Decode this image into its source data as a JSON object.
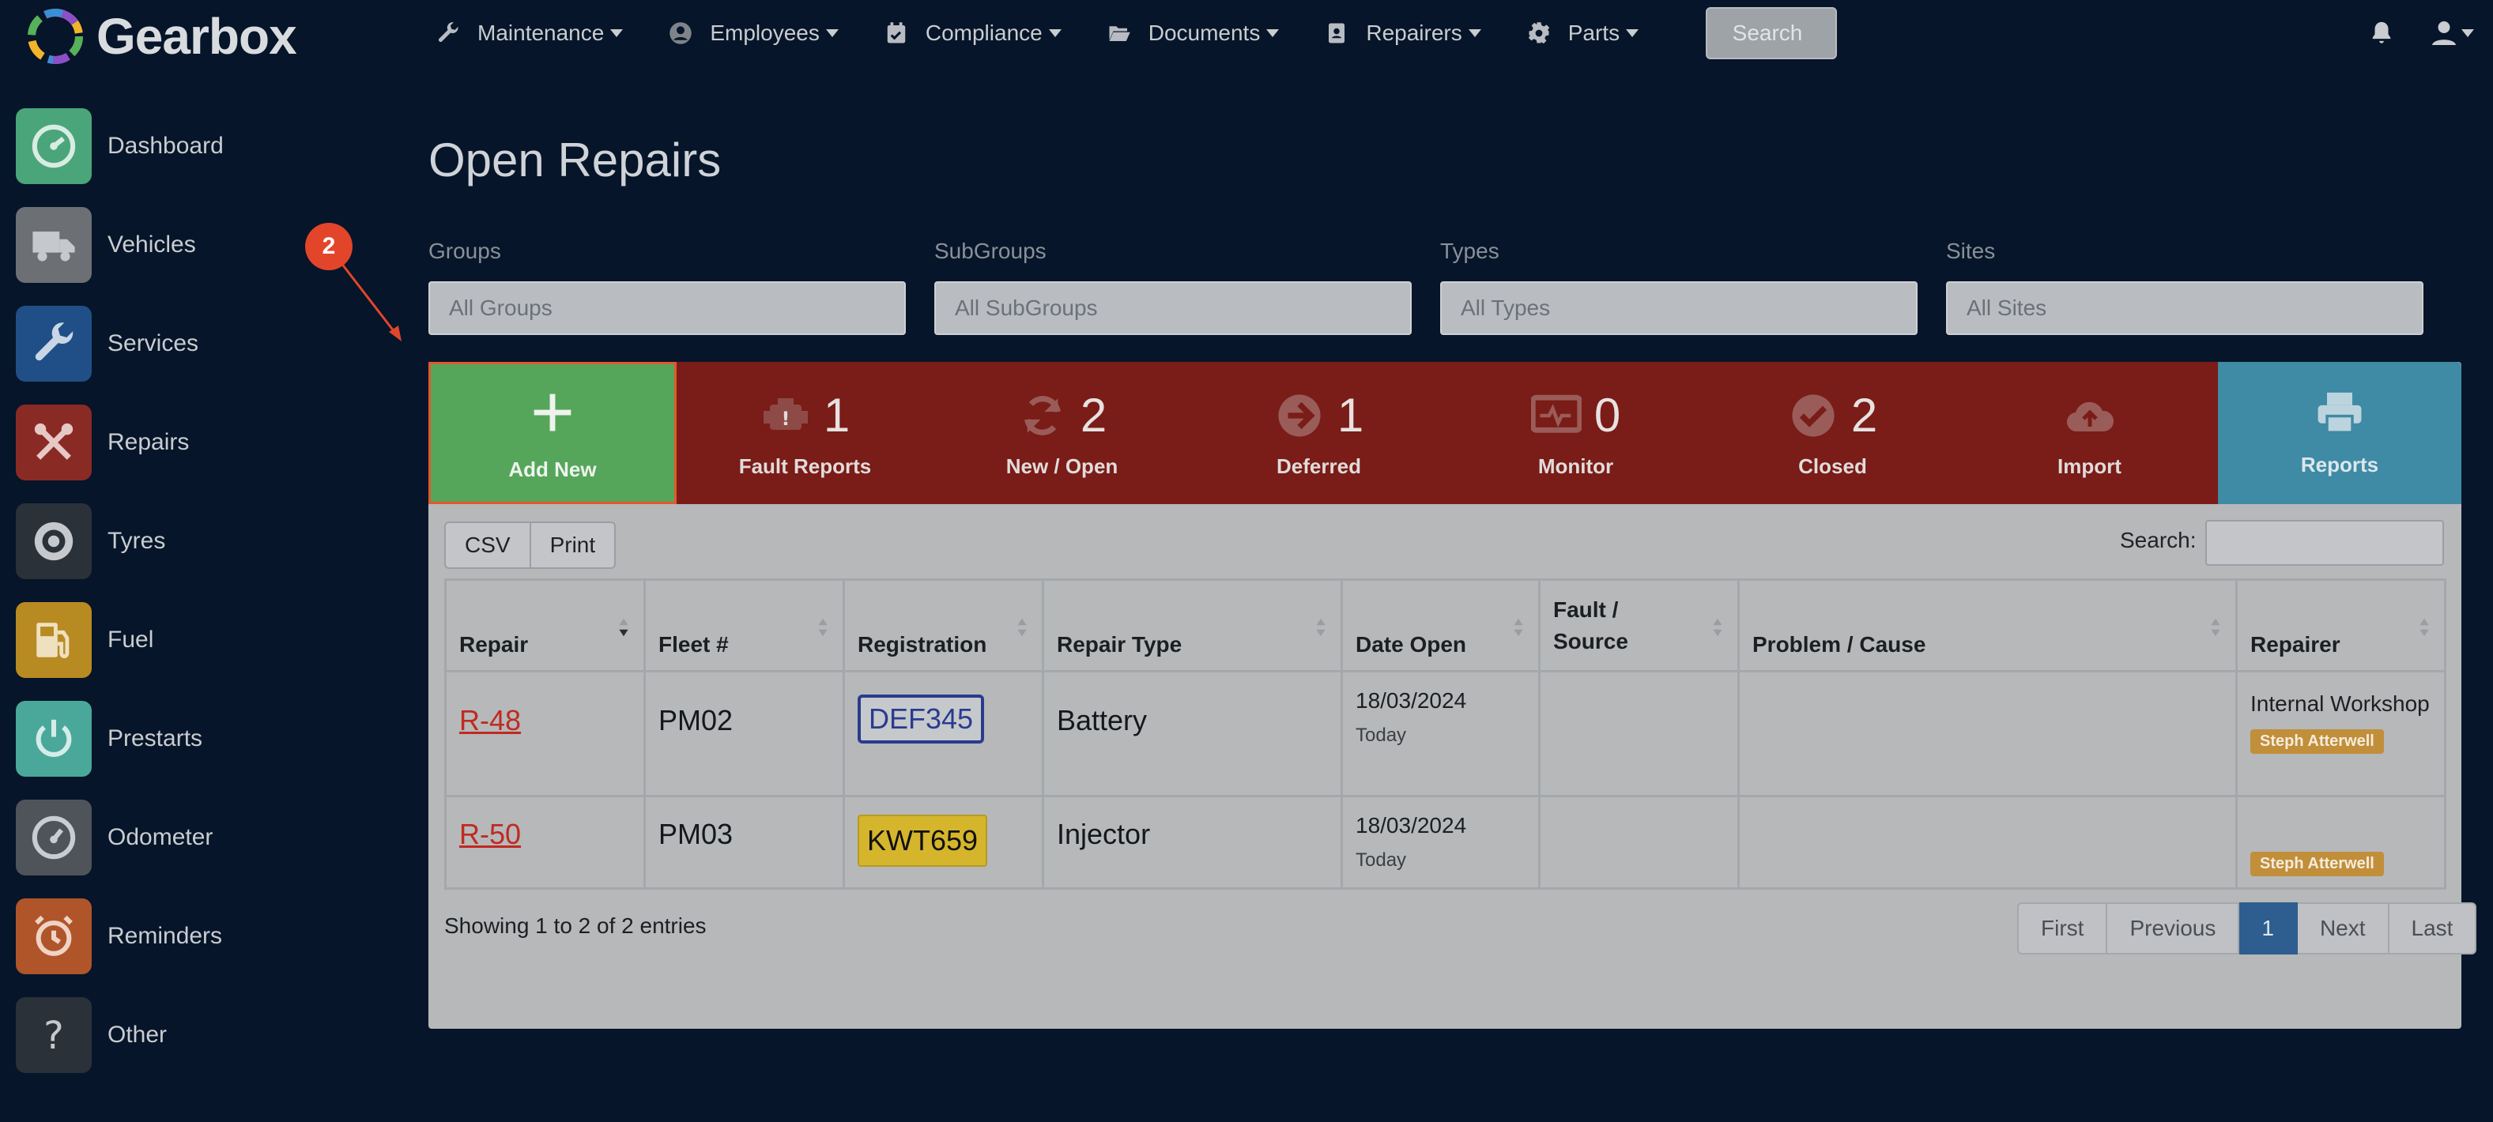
{
  "app": {
    "name": "Gearbox"
  },
  "topnav": {
    "items": [
      {
        "label": "Maintenance",
        "icon": "wrench-icon"
      },
      {
        "label": "Employees",
        "icon": "person-icon"
      },
      {
        "label": "Compliance",
        "icon": "calendar-check-icon"
      },
      {
        "label": "Documents",
        "icon": "folder-open-icon"
      },
      {
        "label": "Repairers",
        "icon": "address-book-icon"
      },
      {
        "label": "Parts",
        "icon": "gear-icon"
      }
    ],
    "search_label": "Search"
  },
  "sidebar": {
    "items": [
      {
        "label": "Dashboard",
        "icon": "dashboard-icon",
        "color": "#4aa57a"
      },
      {
        "label": "Vehicles",
        "icon": "truck-icon",
        "color": "#6c7075"
      },
      {
        "label": "Services",
        "icon": "wrench-icon",
        "color": "#1f4f86"
      },
      {
        "label": "Repairs",
        "icon": "tools-icon",
        "color": "#8a2a25"
      },
      {
        "label": "Tyres",
        "icon": "tyre-icon",
        "color": "#2b3138"
      },
      {
        "label": "Fuel",
        "icon": "fuel-pump-icon",
        "color": "#b88a22"
      },
      {
        "label": "Prestarts",
        "icon": "power-icon",
        "color": "#4aa89a"
      },
      {
        "label": "Odometer",
        "icon": "gauge-icon",
        "color": "#4f545a"
      },
      {
        "label": "Reminders",
        "icon": "alarm-clock-icon",
        "color": "#b0552a"
      },
      {
        "label": "Other",
        "icon": "question-icon",
        "color": "#2b3138"
      }
    ]
  },
  "page": {
    "title": "Open Repairs"
  },
  "filters": [
    {
      "label": "Groups",
      "placeholder": "All Groups"
    },
    {
      "label": "SubGroups",
      "placeholder": "All SubGroups"
    },
    {
      "label": "Types",
      "placeholder": "All Types"
    },
    {
      "label": "Sites",
      "placeholder": "All Sites"
    }
  ],
  "stats": {
    "add_new": "Add New",
    "fault_reports": {
      "count": "1",
      "label": "Fault Reports"
    },
    "new_open": {
      "count": "2",
      "label": "New / Open"
    },
    "deferred": {
      "count": "1",
      "label": "Deferred"
    },
    "monitor": {
      "count": "0",
      "label": "Monitor"
    },
    "closed": {
      "count": "2",
      "label": "Closed"
    },
    "import": {
      "label": "Import"
    },
    "reports": {
      "label": "Reports"
    }
  },
  "toolbar": {
    "csv": "CSV",
    "print": "Print",
    "search_label": "Search:"
  },
  "table": {
    "columns": [
      "Repair",
      "Fleet #",
      "Registration",
      "Repair Type",
      "Date Open",
      "Fault / Source",
      "Problem / Cause",
      "Repairer"
    ],
    "rows": [
      {
        "repair": "R-48",
        "fleet": "PM02",
        "registration": "DEF345",
        "repair_type": "Battery",
        "date_open": "18/03/2024",
        "date_rel": "Today",
        "fault_source": "",
        "problem_cause": "",
        "repairer": "Internal Workshop",
        "badge": "Steph Atterwell"
      },
      {
        "repair": "R-50",
        "fleet": "PM03",
        "registration": "KWT659",
        "repair_type": "Injector",
        "date_open": "18/03/2024",
        "date_rel": "Today",
        "fault_source": "",
        "problem_cause": "",
        "repairer": "",
        "badge": "Steph Atterwell"
      }
    ]
  },
  "footer": {
    "showing": "Showing 1 to 2 of 2 entries",
    "pager": [
      "First",
      "Previous",
      "1",
      "Next",
      "Last"
    ]
  },
  "annotation": {
    "step": "2"
  }
}
